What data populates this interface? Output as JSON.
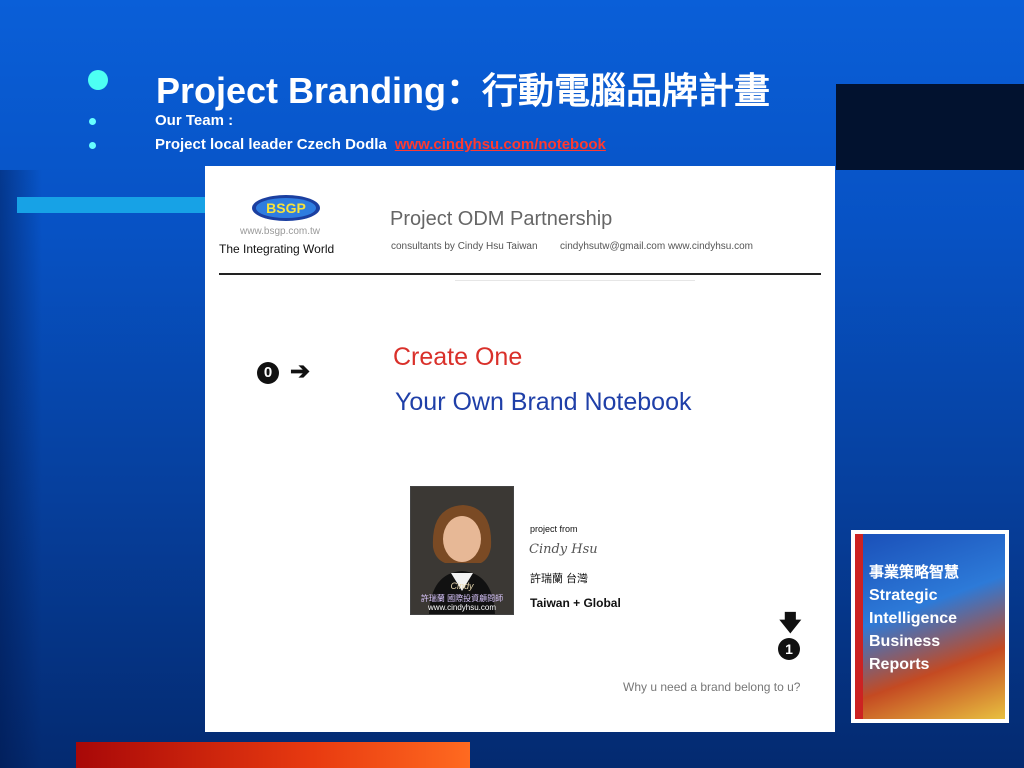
{
  "bullets": {
    "title": "Project Branding：行動電腦品牌計畫",
    "team": "Our Team :",
    "leader": "Project local leader Czech Dodla",
    "link": "www.cindyhsu.com/notebook"
  },
  "slide": {
    "logo_text": "BSGP",
    "logo_url": "www.bsgp.com.tw",
    "tagline": "The Integrating World",
    "odm_title": "Project ODM Partnership",
    "consultants": "consultants by Cindy Hsu Taiwan",
    "contacts": "cindyhsutw@gmail.com   www.cindyhsu.com",
    "zero_icon": "0",
    "arrow_icon": "➔",
    "headline_1": "Create One",
    "headline_2": "Your Own Brand Notebook",
    "photo_caption_1": "Cindy",
    "photo_caption_2": "許瑞蘭 國際投資顧問師",
    "photo_caption_3": "www.cindyhsu.com",
    "project_from": "project from",
    "signature": "Cindy Hsu",
    "name_cn": "許瑞蘭 台灣",
    "tw_global": "Taiwan + Global",
    "down_arrow": "🡇",
    "one_icon": "1",
    "question": "Why u need a brand belong to u?"
  },
  "book": {
    "title_cn": "事業策略智慧",
    "line1": "Strategic",
    "line2": "Intelligence",
    "line3": "Business",
    "line4": "Reports"
  },
  "colors": {
    "background": "#0752c4",
    "bullet_large": "#4dfff3",
    "link": "#ff3a30",
    "headline_red": "#d9302a",
    "headline_blue": "#1f3fa8"
  }
}
